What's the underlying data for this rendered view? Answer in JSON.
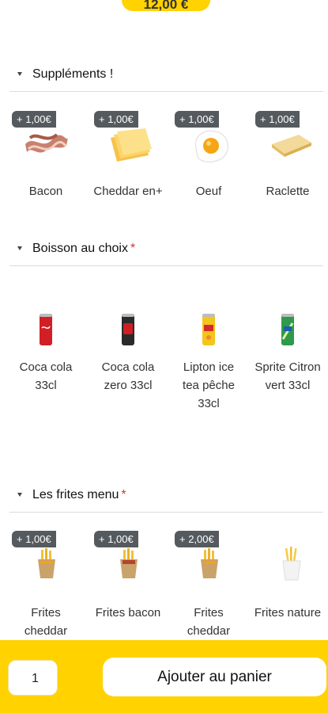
{
  "top_price": "12,00 €",
  "sections": [
    {
      "title": "Suppléments !",
      "required": false,
      "items": [
        {
          "label": "Bacon",
          "badge": "+ 1,00€",
          "icon": "bacon-image"
        },
        {
          "label": "Cheddar en+",
          "badge": "+ 1,00€",
          "icon": "cheddar-slices-image"
        },
        {
          "label": "Oeuf",
          "badge": "+ 1,00€",
          "icon": "fried-egg-image"
        },
        {
          "label": "Raclette",
          "badge": "+ 1,00€",
          "icon": "raclette-cheese-image"
        }
      ]
    },
    {
      "title": "Boisson au choix",
      "required": true,
      "required_mark": "*",
      "items": [
        {
          "label_line1": "Coca cola",
          "label_line2": "33cl",
          "icon": "coca-cola-can-image"
        },
        {
          "label_line1": "Coca cola",
          "label_line2": "zero 33cl",
          "icon": "coca-cola-zero-can-image"
        },
        {
          "label_line1": "Lipton ice",
          "label_line2": "tea pêche",
          "label_line3": "33cl",
          "icon": "lipton-can-image"
        },
        {
          "label_line1": "Sprite Citron",
          "label_line2": "vert 33cl",
          "icon": "sprite-can-image"
        }
      ]
    },
    {
      "title": "Les frites menu",
      "required": true,
      "required_mark": "*",
      "items": [
        {
          "label_line1": "Frites",
          "label_line2": "cheddar",
          "badge": "+ 1,00€",
          "icon": "fries-cheddar-image"
        },
        {
          "label_line1": "Frites bacon",
          "badge": "+ 1,00€",
          "icon": "fries-bacon-image"
        },
        {
          "label_line1": "Frites",
          "label_line2": "cheddar",
          "badge": "+ 2,00€",
          "icon": "fries-cheddar-image"
        },
        {
          "label_line1": "Frites nature",
          "icon": "fries-nature-image"
        }
      ]
    }
  ],
  "footer": {
    "quantity": "1",
    "add_to_cart_label": "Ajouter au panier"
  },
  "colors": {
    "accent": "#ffd200",
    "badge": "#555a5e",
    "required": "#e0302f"
  }
}
